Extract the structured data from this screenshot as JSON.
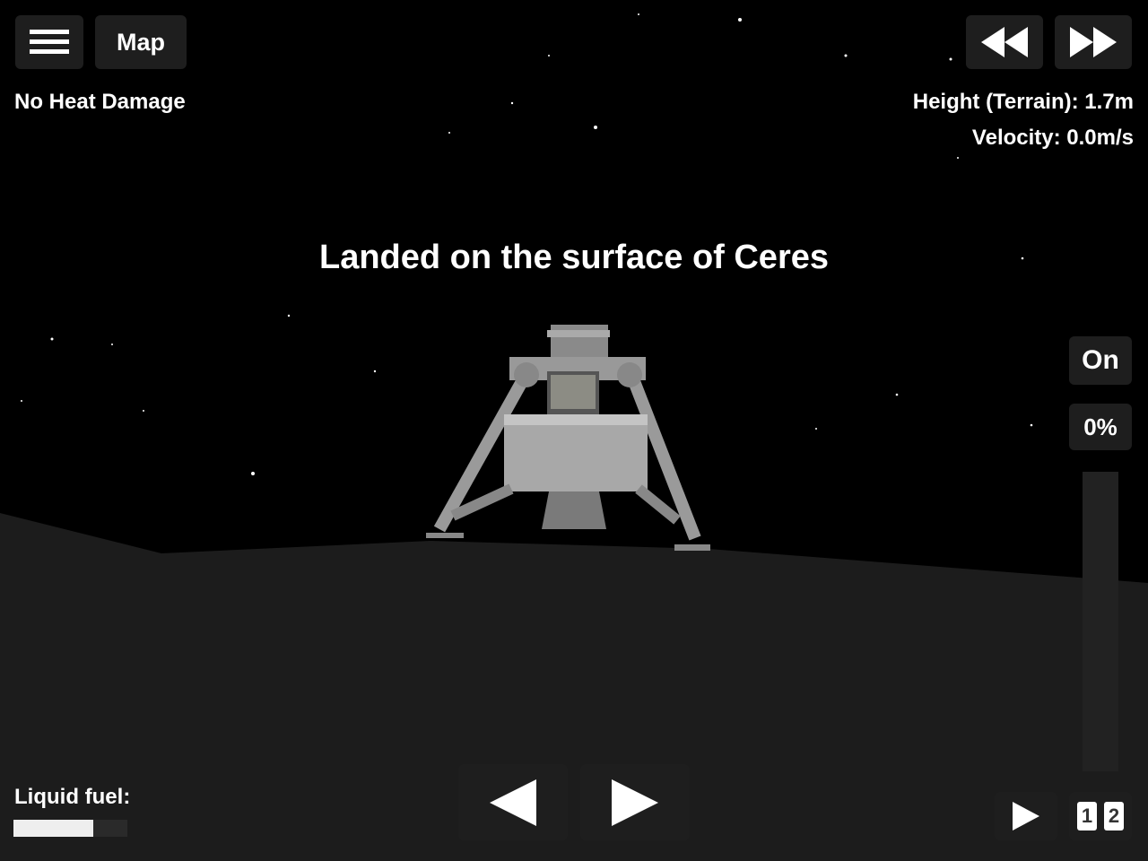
{
  "topbar": {
    "menu_icon": "hamburger-icon",
    "map_label": "Map",
    "rewind_icon": "rewind-icon",
    "fast_forward_icon": "fast-forward-icon"
  },
  "status": {
    "heat": "No Heat Damage",
    "height": "Height (Terrain): 1.7m",
    "velocity": "Velocity: 0.0m/s"
  },
  "message": "Landed on the surface of Ceres",
  "throttle": {
    "engine_label": "On",
    "percent_label": "0%",
    "level": 0
  },
  "fuel": {
    "label": "Liquid fuel:",
    "level": 0.7
  },
  "controls": {
    "rotate_left_icon": "triangle-left-icon",
    "rotate_right_icon": "triangle-right-icon",
    "play_icon": "play-icon",
    "stage_1": "1",
    "stage_2": "2"
  },
  "colors": {
    "sky": "#000000",
    "terrain": "#1c1c1c",
    "button": "#1e1e1e"
  }
}
